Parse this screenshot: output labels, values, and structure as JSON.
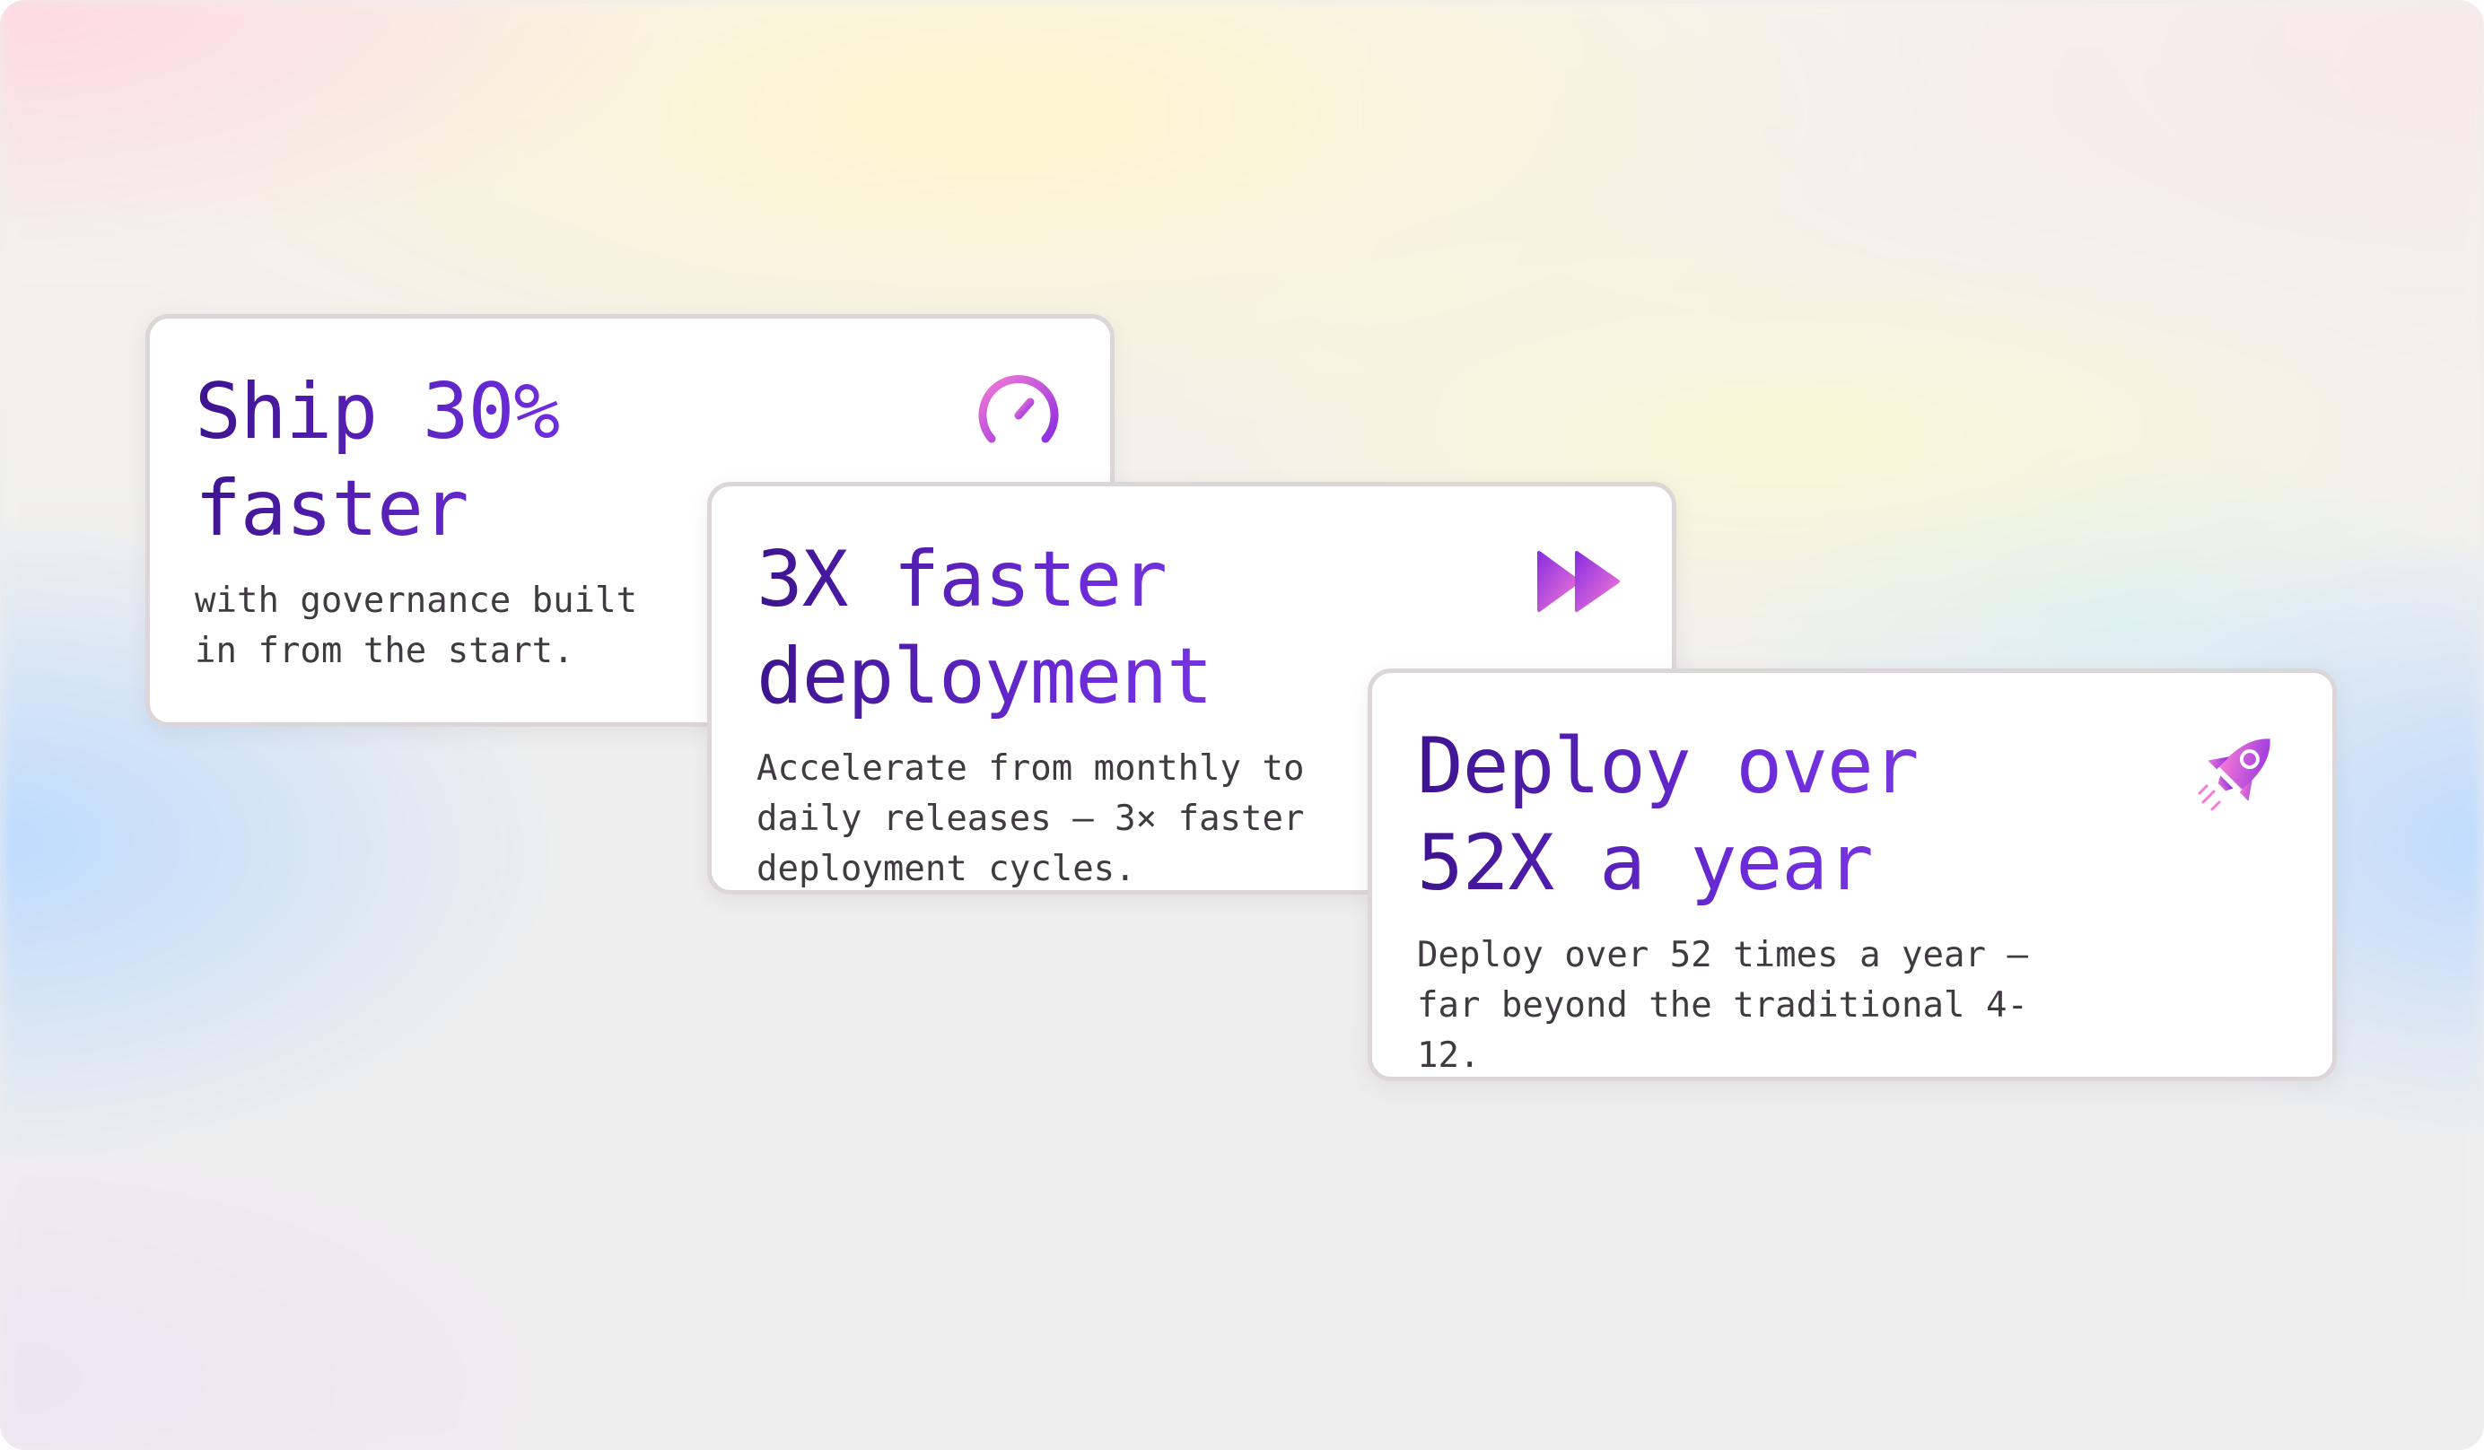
{
  "cards": [
    {
      "title": "Ship 30% faster",
      "description": "with governance built\nin from the start.",
      "icon": "speedometer-icon"
    },
    {
      "title": "3X faster deployment",
      "description": "Accelerate from monthly to\ndaily releases — 3× faster\ndeployment cycles.",
      "icon": "fast-forward-icon"
    },
    {
      "title": "Deploy over 52X a year",
      "description": "Deploy over 52 times a year —\nfar beyond the traditional 4-12.",
      "icon": "rocket-icon"
    }
  ],
  "colors": {
    "title_gradient_start": "#3d148e",
    "title_gradient_end": "#7f3ce6",
    "icon_gradient_start": "#f57bd6",
    "icon_gradient_end": "#8b2ee0",
    "card_border": "#dcd6d8",
    "body_text": "#3f3b41"
  }
}
